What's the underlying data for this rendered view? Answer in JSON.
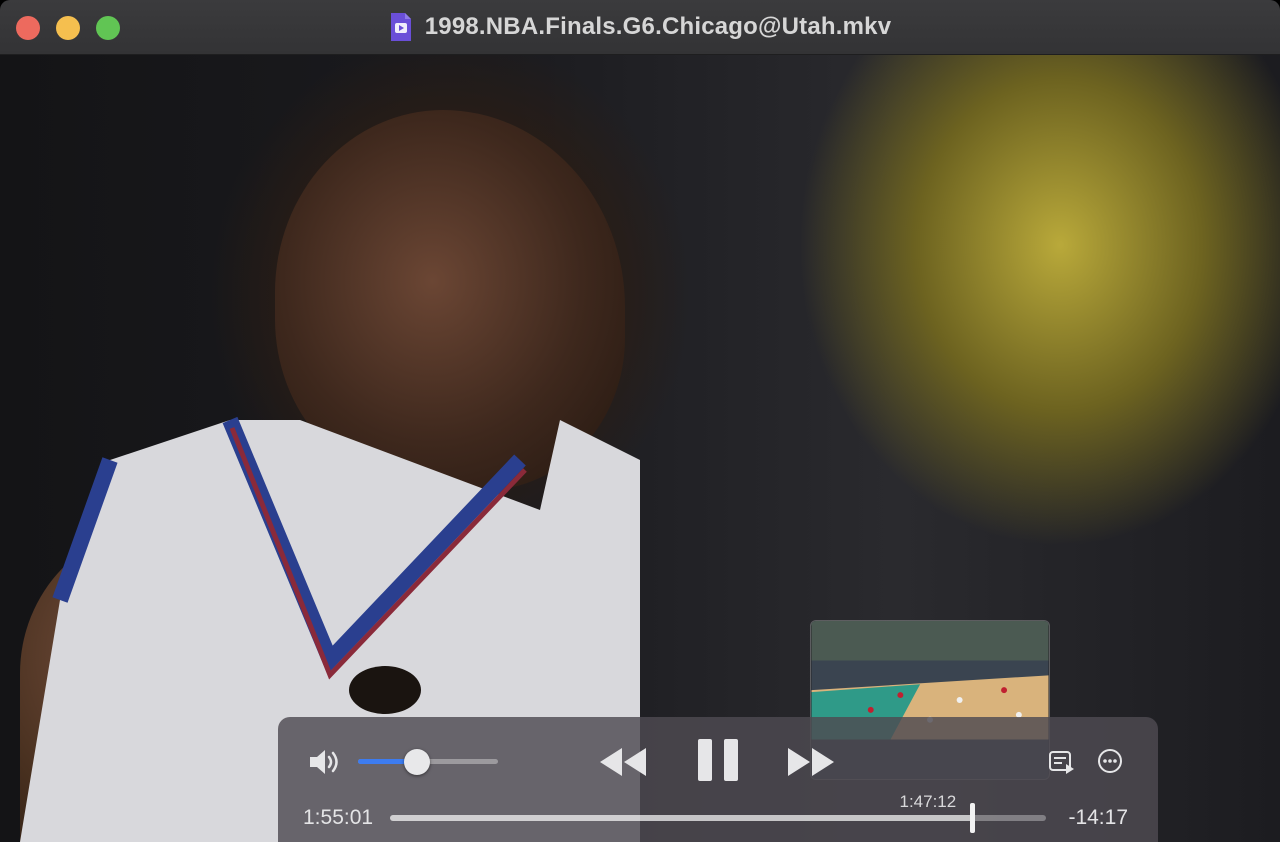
{
  "window": {
    "title": "1998.NBA.Finals.G6.Chicago@Utah.mkv",
    "file_icon": "video-file-icon",
    "buttons": [
      "close",
      "minimize",
      "zoom"
    ]
  },
  "player": {
    "volume_level": 0.42,
    "current_time": "1:55:01",
    "remaining_time": "-14:17",
    "hover_time": "1:47:12",
    "progress_fraction": 0.89,
    "hover_fraction": 0.887,
    "controls": {
      "volume_icon": "speaker-icon",
      "rewind_icon": "rewind-icon",
      "pause_icon": "pause-icon",
      "forward_icon": "fast-forward-icon",
      "playlist_icon": "playlist-icon",
      "more_icon": "more-options-icon"
    }
  },
  "colors": {
    "accent": "#3d7cf0",
    "close": "#ed6a5e",
    "minimize": "#f5bf4f",
    "zoom": "#61c554"
  }
}
